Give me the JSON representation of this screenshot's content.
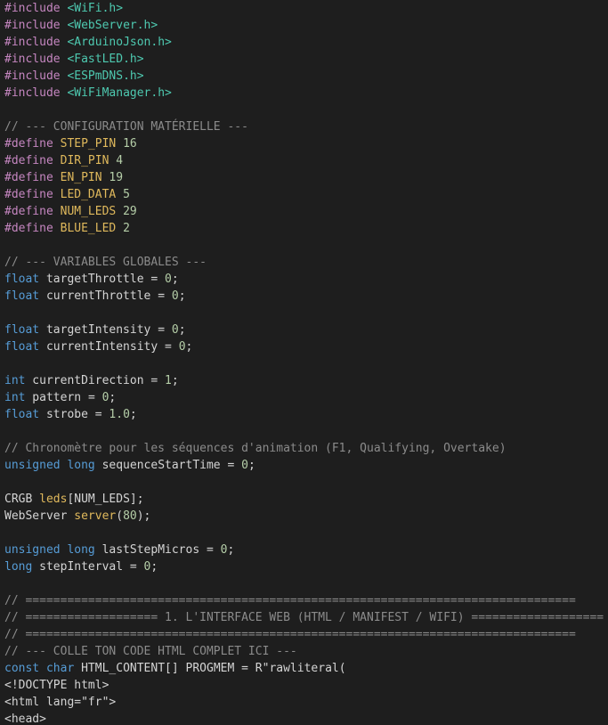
{
  "colors": {
    "background": "#1e1e1e",
    "directive": "#c586c0",
    "include": "#4ec9b0",
    "comment": "#8b8b8b",
    "macro": "#e0b95c",
    "number": "#b5cea8",
    "type": "#569cd6",
    "identifier": "#d4d4d4",
    "operator": "#d4d4d4",
    "punctuation": "#d4d4d4",
    "function": "#e0b95c",
    "string": "#d4d4d4"
  },
  "lines": [
    [
      {
        "t": "directive",
        "v": "#include "
      },
      {
        "t": "include",
        "v": "<WiFi.h>"
      }
    ],
    [
      {
        "t": "directive",
        "v": "#include "
      },
      {
        "t": "include",
        "v": "<WebServer.h>"
      }
    ],
    [
      {
        "t": "directive",
        "v": "#include "
      },
      {
        "t": "include",
        "v": "<ArduinoJson.h>"
      }
    ],
    [
      {
        "t": "directive",
        "v": "#include "
      },
      {
        "t": "include",
        "v": "<FastLED.h>"
      }
    ],
    [
      {
        "t": "directive",
        "v": "#include "
      },
      {
        "t": "include",
        "v": "<ESPmDNS.h>"
      }
    ],
    [
      {
        "t": "directive",
        "v": "#include "
      },
      {
        "t": "include",
        "v": "<WiFiManager.h>"
      }
    ],
    [],
    [
      {
        "t": "comment",
        "v": "// --- CONFIGURATION MATÉRIELLE ---"
      }
    ],
    [
      {
        "t": "directive",
        "v": "#define "
      },
      {
        "t": "macro",
        "v": "STEP_PIN"
      },
      {
        "t": "ident",
        "v": " "
      },
      {
        "t": "num",
        "v": "16"
      }
    ],
    [
      {
        "t": "directive",
        "v": "#define "
      },
      {
        "t": "macro",
        "v": "DIR_PIN"
      },
      {
        "t": "ident",
        "v": " "
      },
      {
        "t": "num",
        "v": "4"
      }
    ],
    [
      {
        "t": "directive",
        "v": "#define "
      },
      {
        "t": "macro",
        "v": "EN_PIN"
      },
      {
        "t": "ident",
        "v": " "
      },
      {
        "t": "num",
        "v": "19"
      }
    ],
    [
      {
        "t": "directive",
        "v": "#define "
      },
      {
        "t": "macro",
        "v": "LED_DATA"
      },
      {
        "t": "ident",
        "v": " "
      },
      {
        "t": "num",
        "v": "5"
      }
    ],
    [
      {
        "t": "directive",
        "v": "#define "
      },
      {
        "t": "macro",
        "v": "NUM_LEDS"
      },
      {
        "t": "ident",
        "v": " "
      },
      {
        "t": "num",
        "v": "29"
      }
    ],
    [
      {
        "t": "directive",
        "v": "#define "
      },
      {
        "t": "macro",
        "v": "BLUE_LED"
      },
      {
        "t": "ident",
        "v": " "
      },
      {
        "t": "num",
        "v": "2"
      }
    ],
    [],
    [
      {
        "t": "comment",
        "v": "// --- VARIABLES GLOBALES ---"
      }
    ],
    [
      {
        "t": "type",
        "v": "float"
      },
      {
        "t": "ident",
        "v": " targetThrottle "
      },
      {
        "t": "op",
        "v": "="
      },
      {
        "t": "ident",
        "v": " "
      },
      {
        "t": "num",
        "v": "0"
      },
      {
        "t": "punc",
        "v": ";"
      }
    ],
    [
      {
        "t": "type",
        "v": "float"
      },
      {
        "t": "ident",
        "v": " currentThrottle "
      },
      {
        "t": "op",
        "v": "="
      },
      {
        "t": "ident",
        "v": " "
      },
      {
        "t": "num",
        "v": "0"
      },
      {
        "t": "punc",
        "v": ";"
      }
    ],
    [],
    [
      {
        "t": "type",
        "v": "float"
      },
      {
        "t": "ident",
        "v": " targetIntensity "
      },
      {
        "t": "op",
        "v": "="
      },
      {
        "t": "ident",
        "v": " "
      },
      {
        "t": "num",
        "v": "0"
      },
      {
        "t": "punc",
        "v": ";"
      }
    ],
    [
      {
        "t": "type",
        "v": "float"
      },
      {
        "t": "ident",
        "v": " currentIntensity "
      },
      {
        "t": "op",
        "v": "="
      },
      {
        "t": "ident",
        "v": " "
      },
      {
        "t": "num",
        "v": "0"
      },
      {
        "t": "punc",
        "v": ";"
      }
    ],
    [],
    [
      {
        "t": "type",
        "v": "int"
      },
      {
        "t": "ident",
        "v": " currentDirection "
      },
      {
        "t": "op",
        "v": "="
      },
      {
        "t": "ident",
        "v": " "
      },
      {
        "t": "num",
        "v": "1"
      },
      {
        "t": "punc",
        "v": ";"
      }
    ],
    [
      {
        "t": "type",
        "v": "int"
      },
      {
        "t": "ident",
        "v": " pattern "
      },
      {
        "t": "op",
        "v": "="
      },
      {
        "t": "ident",
        "v": " "
      },
      {
        "t": "num",
        "v": "0"
      },
      {
        "t": "punc",
        "v": ";"
      }
    ],
    [
      {
        "t": "type",
        "v": "float"
      },
      {
        "t": "ident",
        "v": " strobe "
      },
      {
        "t": "op",
        "v": "="
      },
      {
        "t": "ident",
        "v": " "
      },
      {
        "t": "num",
        "v": "1.0"
      },
      {
        "t": "punc",
        "v": ";"
      }
    ],
    [],
    [
      {
        "t": "comment",
        "v": "// Chronomètre pour les séquences d'animation (F1, Qualifying, Overtake)"
      }
    ],
    [
      {
        "t": "type",
        "v": "unsigned long"
      },
      {
        "t": "ident",
        "v": " sequenceStartTime "
      },
      {
        "t": "op",
        "v": "="
      },
      {
        "t": "ident",
        "v": " "
      },
      {
        "t": "num",
        "v": "0"
      },
      {
        "t": "punc",
        "v": ";"
      }
    ],
    [],
    [
      {
        "t": "ident",
        "v": "CRGB "
      },
      {
        "t": "func",
        "v": "leds"
      },
      {
        "t": "punc",
        "v": "["
      },
      {
        "t": "ident",
        "v": "NUM_LEDS"
      },
      {
        "t": "punc",
        "v": "];"
      }
    ],
    [
      {
        "t": "ident",
        "v": "WebServer "
      },
      {
        "t": "func",
        "v": "server"
      },
      {
        "t": "punc",
        "v": "("
      },
      {
        "t": "num",
        "v": "80"
      },
      {
        "t": "punc",
        "v": ");"
      }
    ],
    [],
    [
      {
        "t": "type",
        "v": "unsigned long"
      },
      {
        "t": "ident",
        "v": " lastStepMicros "
      },
      {
        "t": "op",
        "v": "="
      },
      {
        "t": "ident",
        "v": " "
      },
      {
        "t": "num",
        "v": "0"
      },
      {
        "t": "punc",
        "v": ";"
      }
    ],
    [
      {
        "t": "type",
        "v": "long"
      },
      {
        "t": "ident",
        "v": " stepInterval "
      },
      {
        "t": "op",
        "v": "="
      },
      {
        "t": "ident",
        "v": " "
      },
      {
        "t": "num",
        "v": "0"
      },
      {
        "t": "punc",
        "v": ";"
      }
    ],
    [],
    [
      {
        "t": "comment",
        "v": "// ==============================================================================="
      }
    ],
    [
      {
        "t": "comment",
        "v": "// =================== 1. L'INTERFACE WEB (HTML / MANIFEST / WIFI) ==================="
      }
    ],
    [
      {
        "t": "comment",
        "v": "// ==============================================================================="
      }
    ],
    [
      {
        "t": "comment",
        "v": "// --- COLLE TON CODE HTML COMPLET ICI ---"
      }
    ],
    [
      {
        "t": "type",
        "v": "const char"
      },
      {
        "t": "ident",
        "v": " HTML_CONTENT"
      },
      {
        "t": "punc",
        "v": "[]"
      },
      {
        "t": "ident",
        "v": " PROGMEM "
      },
      {
        "t": "op",
        "v": "="
      },
      {
        "t": "ident",
        "v": " R"
      },
      {
        "t": "str",
        "v": "\"rawliteral("
      }
    ],
    [
      {
        "t": "str",
        "v": "<!DOCTYPE html>"
      }
    ],
    [
      {
        "t": "str",
        "v": "<html lang=\"fr\">"
      }
    ],
    [
      {
        "t": "str",
        "v": "<head>"
      }
    ]
  ]
}
